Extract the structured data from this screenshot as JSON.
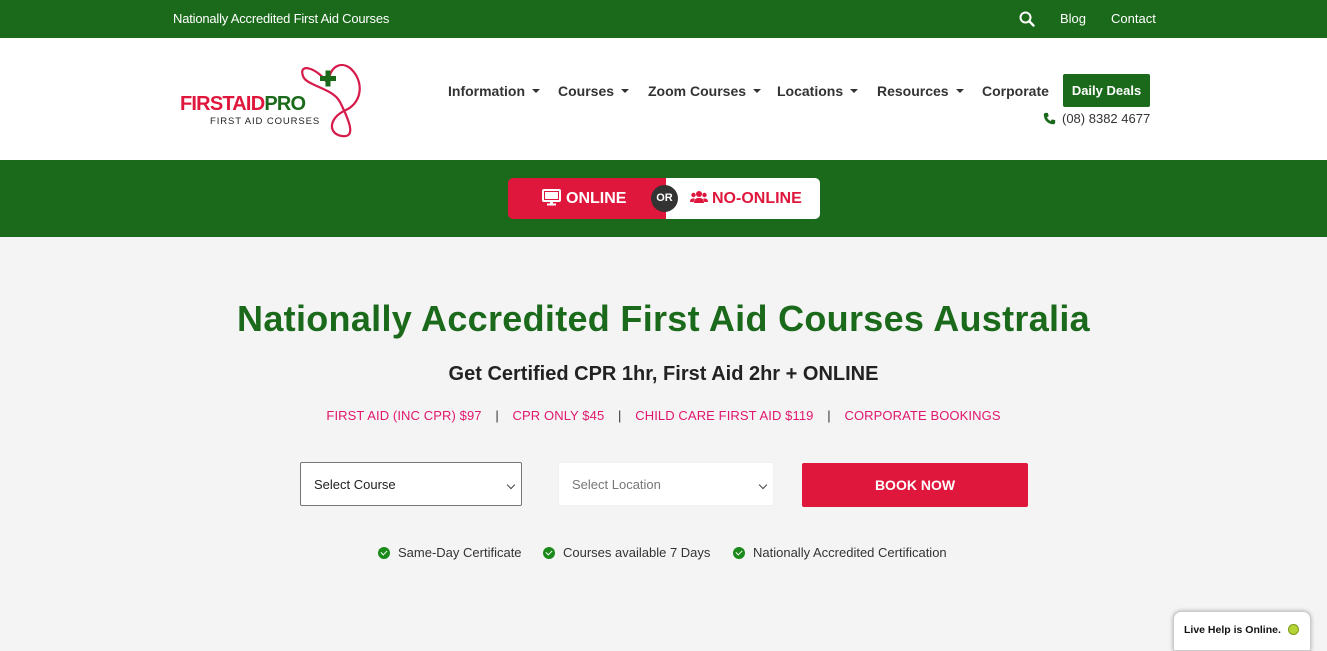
{
  "topbar": {
    "tagline": "Nationally Accredited First Aid Courses",
    "blog": "Blog",
    "contact": "Contact",
    "search_icon": "search-icon"
  },
  "logo": {
    "word_red": "FIRSTAID",
    "word_green": "PRO",
    "subtitle": "FIRST AID COURSES"
  },
  "nav": {
    "items": [
      {
        "label": "Information",
        "dropdown": true
      },
      {
        "label": "Courses",
        "dropdown": true
      },
      {
        "label": "Zoom Courses",
        "dropdown": true
      },
      {
        "label": "Locations",
        "dropdown": true
      },
      {
        "label": "Resources",
        "dropdown": true
      },
      {
        "label": "Corporate",
        "dropdown": false
      }
    ],
    "deals_label": "Daily Deals",
    "phone": "(08) 8382 4677"
  },
  "mode_toggle": {
    "online_label": "ONLINE",
    "or_label": "OR",
    "offline_label": "NO-ONLINE"
  },
  "hero": {
    "title": "Nationally Accredited First Aid Courses Australia",
    "subtitle": "Get Certified CPR 1hr, First Aid 2hr + ONLINE",
    "price_links": [
      "FIRST AID (INC CPR) $97",
      "CPR ONLY $45",
      "CHILD CARE FIRST AID $119",
      "CORPORATE BOOKINGS"
    ],
    "separator": "|"
  },
  "booking": {
    "course_select": "Select Course",
    "location_select": "Select Location",
    "book_label": "BOOK NOW"
  },
  "features": [
    "Same-Day Certificate",
    "Courses available 7 Days",
    "Nationally Accredited Certification"
  ],
  "livehelp": {
    "label": "Live Help is Online."
  },
  "colors": {
    "brand_green": "#1b6a1b",
    "brand_red": "#e0173c",
    "link_pink": "#e0176e"
  }
}
